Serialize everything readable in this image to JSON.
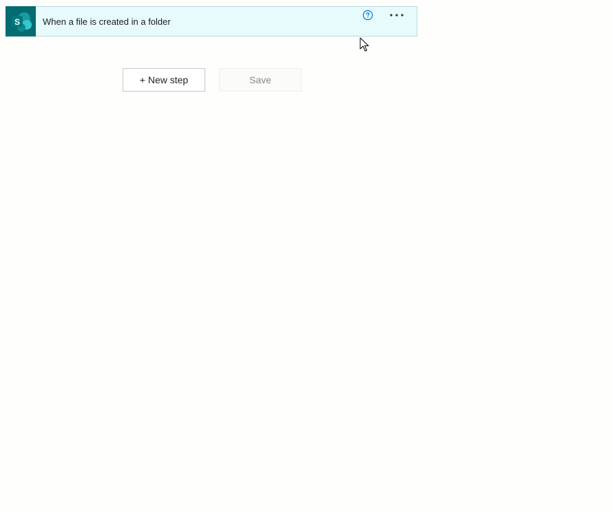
{
  "trigger": {
    "title": "When a file is created in a folder",
    "connector_letter": "S",
    "connector_icon": "sharepoint-icon",
    "help_icon": "help-icon",
    "more_icon": "more-options-icon"
  },
  "actions": {
    "new_step_label": "+ New step",
    "save_label": "Save"
  },
  "colors": {
    "connector_bg": "#036c70",
    "card_bg": "#e7fbfc",
    "accent_blue": "#0078d4"
  }
}
